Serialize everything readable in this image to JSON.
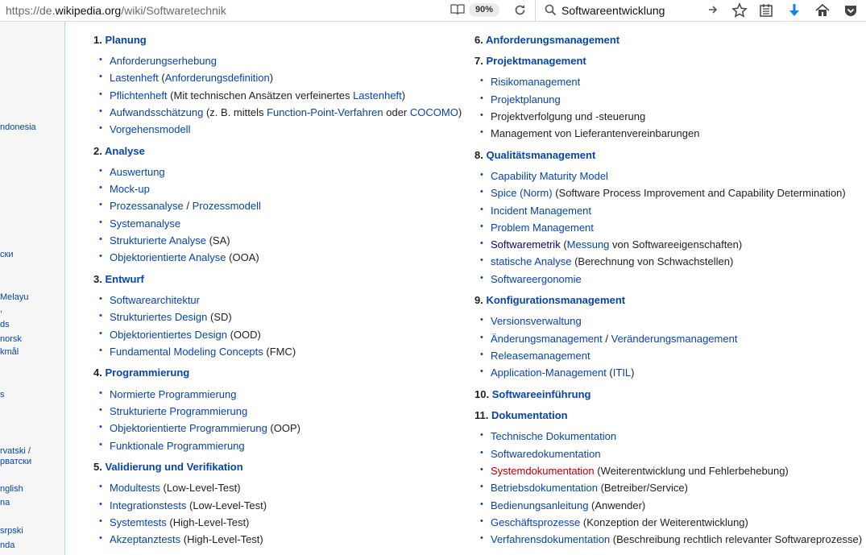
{
  "browser": {
    "url_prefix": "https://de.",
    "url_host": "wikipedia.org",
    "url_path": "/wiki/Softwaretechnik",
    "zoom": "90%",
    "search_value": "Softwareentwicklung"
  },
  "sidebar": {
    "langs": [
      "ndonesia",
      "ски",
      "Melayu",
      ",",
      "ds",
      "norsk",
      "kmål",
      "s",
      "rvatski /",
      "рватски",
      "nglish",
      "na",
      "srpski",
      "nda"
    ]
  },
  "left": {
    "s1": {
      "num": "1.",
      "title": "Planung",
      "i1": {
        "a": "Anforderungserhebung"
      },
      "i2": {
        "a": "Lastenheft",
        "t1": " (",
        "b": "Anforderungsdefinition",
        "t2": ")"
      },
      "i3": {
        "a": "Pflichtenheft",
        "t1": " (Mit technischen Ansätzen verfeinertes ",
        "b": "Lastenheft",
        "t2": ")"
      },
      "i4": {
        "a": "Aufwandsschätzung",
        "t1": " (z. B. mittels ",
        "b": "Function-Point-Verfahren",
        "t2": " oder ",
        "c": "COCOMO",
        "t3": ")"
      },
      "i5": {
        "a": "Vorgehensmodell"
      }
    },
    "s2": {
      "num": "2.",
      "title": "Analyse",
      "i1": {
        "a": "Auswertung"
      },
      "i2": {
        "a": "Mock-up"
      },
      "i3": {
        "a": "Prozessanalyse",
        "t1": " / ",
        "b": "Prozessmodell"
      },
      "i4": {
        "a": "Systemanalyse"
      },
      "i5": {
        "a": "Strukturierte Analyse",
        "t1": " (SA)"
      },
      "i6": {
        "a": "Objektorientierte Analyse",
        "t1": " (OOA)"
      }
    },
    "s3": {
      "num": "3.",
      "title": "Entwurf",
      "i1": {
        "a": "Softwarearchitektur"
      },
      "i2": {
        "a": "Strukturiertes Design",
        "t1": " (SD)"
      },
      "i3": {
        "a": "Objektorientiertes Design",
        "t1": " (OOD)"
      },
      "i4": {
        "a": "Fundamental Modeling Concepts",
        "t1": " (FMC)"
      }
    },
    "s4": {
      "num": "4.",
      "title": "Programmierung",
      "i1": {
        "a": "Normierte Programmierung"
      },
      "i2": {
        "a": "Strukturierte Programmierung"
      },
      "i3": {
        "a": "Objektorientierte Programmierung",
        "t1": " (OOP)"
      },
      "i4": {
        "a": "Funktionale Programmierung"
      }
    },
    "s5": {
      "num": "5.",
      "title": "Validierung und Verifikation",
      "i1": {
        "a": "Modultests",
        "t1": " (Low-Level-Test)"
      },
      "i2": {
        "a": "Integrationstests",
        "t1": " (Low-Level-Test)"
      },
      "i3": {
        "a": "Systemtests",
        "t1": " (High-Level-Test)"
      },
      "i4": {
        "a": "Akzeptanztests",
        "t1": " (High-Level-Test)"
      }
    }
  },
  "right": {
    "s6": {
      "num": "6.",
      "title": "Anforderungsmanagement"
    },
    "s7": {
      "num": "7.",
      "title": "Projektmanagement",
      "i1": {
        "a": "Risikomanagement"
      },
      "i2": {
        "a": "Projektplanung"
      },
      "i3": {
        "t1": "Projektverfolgung und -steuerung"
      },
      "i4": {
        "t1": "Management von Lieferantenvereinbarungen"
      }
    },
    "s8": {
      "num": "8.",
      "title": "Qualitätsmanagement",
      "i1": {
        "a": "Capability Maturity Model"
      },
      "i2": {
        "a": "Spice (Norm)",
        "t1": " (Software Process Improvement and Capability Determination)"
      },
      "i3": {
        "a": "Incident Management"
      },
      "i4": {
        "a": "Problem Management"
      },
      "i5": {
        "a": "Softwaremetrik",
        "t1": " (",
        "b": "Messung",
        "t2": " von Softwareeigenschaften)"
      },
      "i6": {
        "a": "statische Analyse",
        "t1": " (Berechnung von Schwachstellen)"
      },
      "i7": {
        "a": "Softwareergonomie"
      }
    },
    "s9": {
      "num": "9.",
      "title": "Konfigurationsmanagement",
      "i1": {
        "a": "Versionsverwaltung"
      },
      "i2": {
        "a": "Änderungsmanagement",
        "t1": " / ",
        "b": "Veränderungsmanagement"
      },
      "i3": {
        "a": "Releasemanagement"
      },
      "i4": {
        "a": "Application-Management",
        "t1": " (",
        "b": "ITIL",
        "t2": ")"
      }
    },
    "s10": {
      "num": "10.",
      "title": "Softwareeinführung"
    },
    "s11": {
      "num": "11.",
      "title": "Dokumentation",
      "i1": {
        "a": "Technische Dokumentation"
      },
      "i2": {
        "a": "Softwaredokumentation"
      },
      "i3": {
        "a": "Systemdokumentation",
        "t1": " (Weiterentwicklung und Fehlerbehebung)"
      },
      "i4": {
        "a": "Betriebsdokumentation",
        "t1": " (Betreiber/Service)"
      },
      "i5": {
        "a": "Bedienungsanleitung",
        "t1": " (Anwender)"
      },
      "i6": {
        "a": "Geschäftsprozesse",
        "t1": " (Konzeption der Weiterentwicklung)"
      },
      "i7": {
        "a": "Verfahrensdokumentation",
        "t1": " (Beschreibung rechtlich relevanter Softwareprozesse)"
      }
    }
  }
}
